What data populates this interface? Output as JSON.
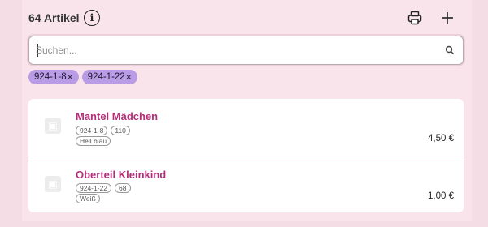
{
  "header": {
    "count_label": "64 Artikel",
    "info_symbol": "i",
    "icons": {
      "info": "info-icon",
      "print": "printer-icon",
      "add": "plus-icon"
    }
  },
  "search": {
    "placeholder": "Suchen...",
    "value": "",
    "icon": "search-icon"
  },
  "filters": [
    {
      "label": "924-1-8",
      "remove": "×"
    },
    {
      "label": "924-1-22",
      "remove": "×"
    }
  ],
  "items": [
    {
      "title": "Mantel Mädchen",
      "code": "924-1-8",
      "size": "110",
      "color": "Hell blau",
      "price": "4,50 €",
      "thumb_icon": "image-placeholder-icon"
    },
    {
      "title": "Oberteil Kleinkind",
      "code": "924-1-22",
      "size": "68",
      "color": "Weiß",
      "price": "1,00 €",
      "thumb_icon": "image-placeholder-icon"
    }
  ],
  "colors": {
    "background": "#f4dde5",
    "accent_title": "#b22e78",
    "chip": "#b99be6"
  }
}
